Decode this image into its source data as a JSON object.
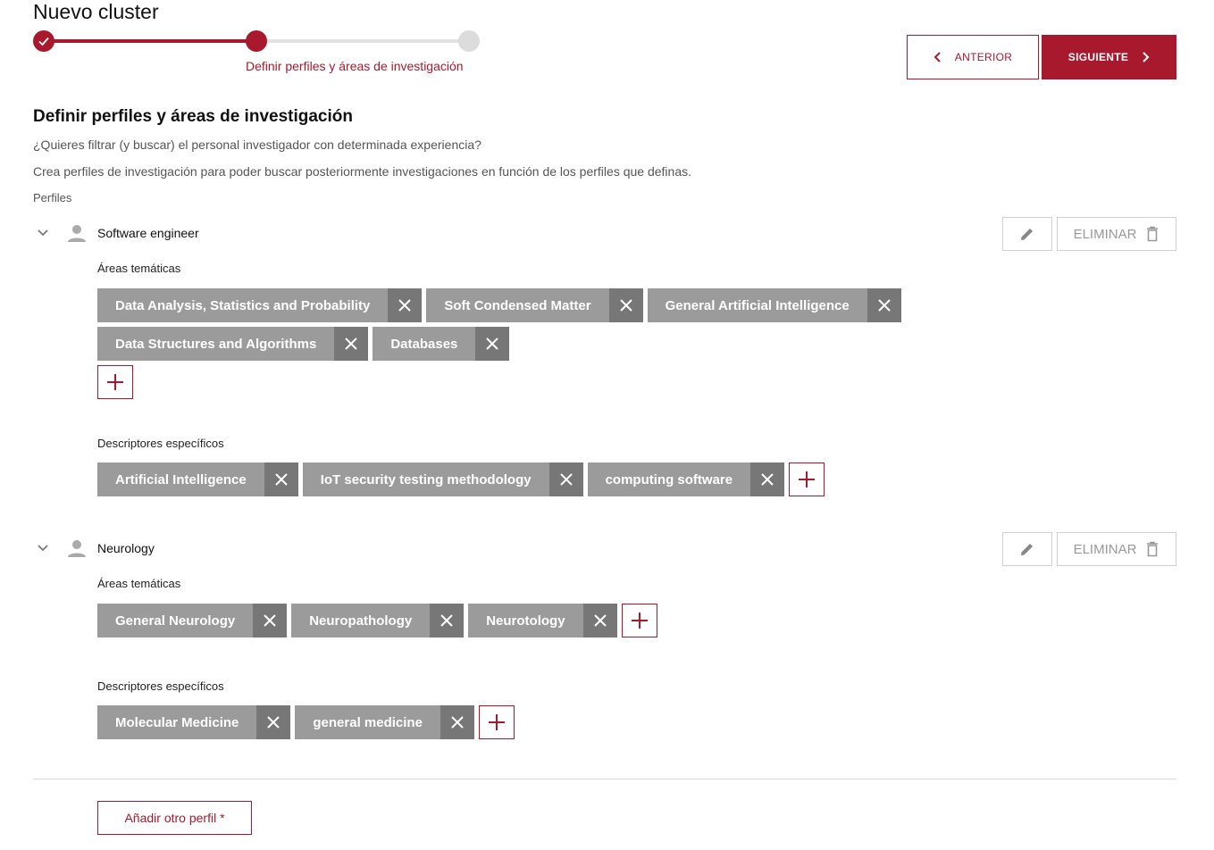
{
  "header": {
    "title": "Nuevo cluster",
    "current_step_label": "Definir perfiles y áreas de investigación"
  },
  "stepper": {
    "total_steps": 3,
    "current_step": 2
  },
  "nav": {
    "prev_label": "ANTERIOR",
    "next_label": "SIGUIENTE"
  },
  "section": {
    "title": "Definir perfiles y áreas de investigación",
    "desc1": "¿Quieres filtrar (y buscar) el personal investigador con determinada experiencia?",
    "desc2": "Crea perfiles de investigación para poder buscar posteriormente investigaciones en función de los perfiles que definas.",
    "profiles_label": "Perfiles"
  },
  "profiles": [
    {
      "name": "Software engineer",
      "delete_label": "ELIMINAR",
      "areas_label": "Áreas temáticas",
      "areas": [
        "Data Analysis, Statistics and Probability",
        "Soft Condensed Matter",
        "General Artificial Intelligence",
        "Data Structures and Algorithms",
        "Databases"
      ],
      "descriptors_label": "Descriptores específicos",
      "descriptors": [
        "Artificial Intelligence",
        "IoT security testing methodology",
        "computing software"
      ]
    },
    {
      "name": "Neurology",
      "delete_label": "ELIMINAR",
      "areas_label": "Áreas temáticas",
      "areas": [
        "General Neurology",
        "Neuropathology",
        "Neurotology"
      ],
      "descriptors_label": "Descriptores específicos",
      "descriptors": [
        "Molecular Medicine",
        "general medicine"
      ]
    }
  ],
  "footer": {
    "add_profile_label": "Añadir otro perfil *"
  },
  "colors": {
    "accent": "#a8192e",
    "tag_bg": "#9b9b9b",
    "tag_close_bg": "#777777",
    "inactive": "#dcdcdc"
  },
  "icons": [
    "check-icon",
    "chevron-left-icon",
    "chevron-right-icon",
    "chevron-down-icon",
    "person-icon",
    "pencil-icon",
    "trash-icon",
    "close-icon",
    "plus-icon"
  ]
}
